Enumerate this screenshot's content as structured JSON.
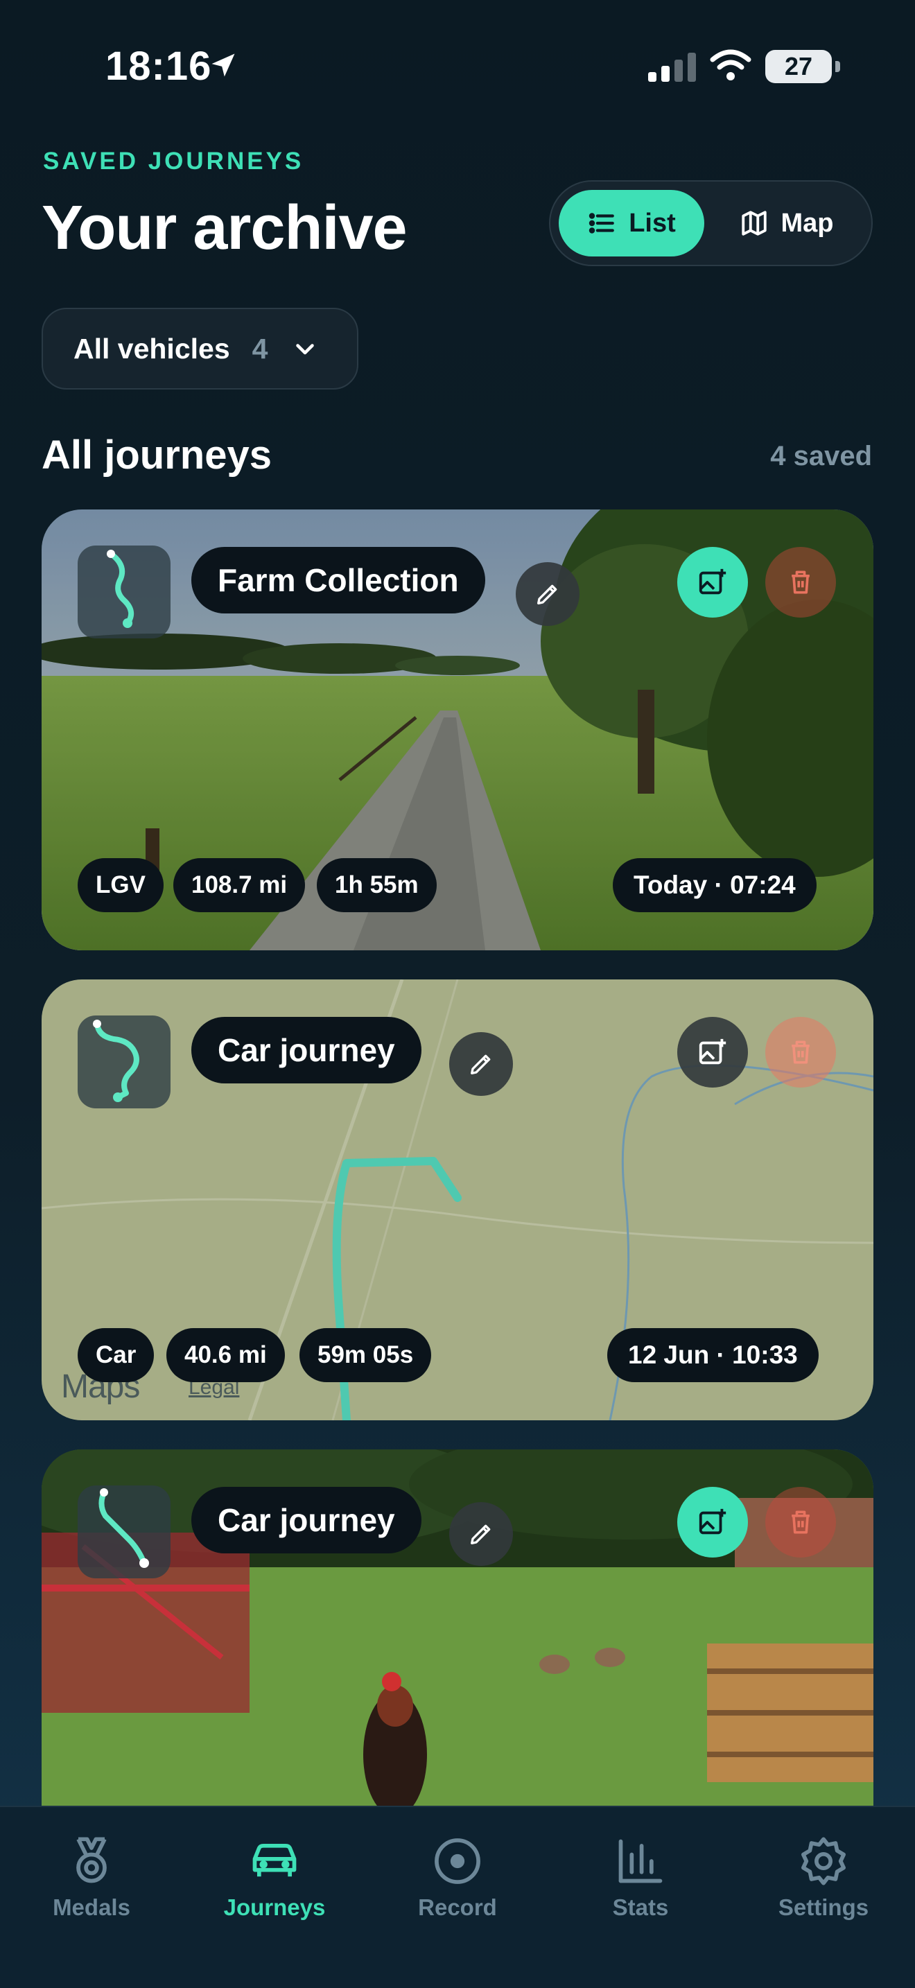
{
  "status_bar": {
    "time": "18:16",
    "battery": "27"
  },
  "header": {
    "eyebrow": "SAVED JOURNEYS",
    "title": "Your archive",
    "view_toggle": {
      "list_label": "List",
      "map_label": "Map",
      "selected": "List"
    }
  },
  "filter": {
    "label": "All vehicles",
    "count": "4"
  },
  "section": {
    "title": "All journeys",
    "count": "4 saved"
  },
  "journeys": [
    {
      "name": "Farm Collection",
      "vehicle": "LGV",
      "distance": "108.7 mi",
      "duration": "1h 55m",
      "date": "Today · 07:24",
      "background": "photo"
    },
    {
      "name": "Car journey",
      "vehicle": "Car",
      "distance": "40.6 mi",
      "duration": "59m 05s",
      "date": "12 Jun · 10:33",
      "background": "map",
      "map_attribution": {
        "logo": "Maps",
        "legal": "Legal"
      }
    },
    {
      "name": "Car journey",
      "background": "photo"
    }
  ],
  "tabs": [
    {
      "label": "Medals",
      "icon": "medal-icon"
    },
    {
      "label": "Journeys",
      "icon": "car-icon",
      "active": true
    },
    {
      "label": "Record",
      "icon": "record-icon"
    },
    {
      "label": "Stats",
      "icon": "stats-icon"
    },
    {
      "label": "Settings",
      "icon": "settings-icon"
    }
  ],
  "colors": {
    "accent": "#3ee0b6",
    "background": "#0b1a23",
    "chip": "#0b141b",
    "delete": "#c8463c"
  }
}
